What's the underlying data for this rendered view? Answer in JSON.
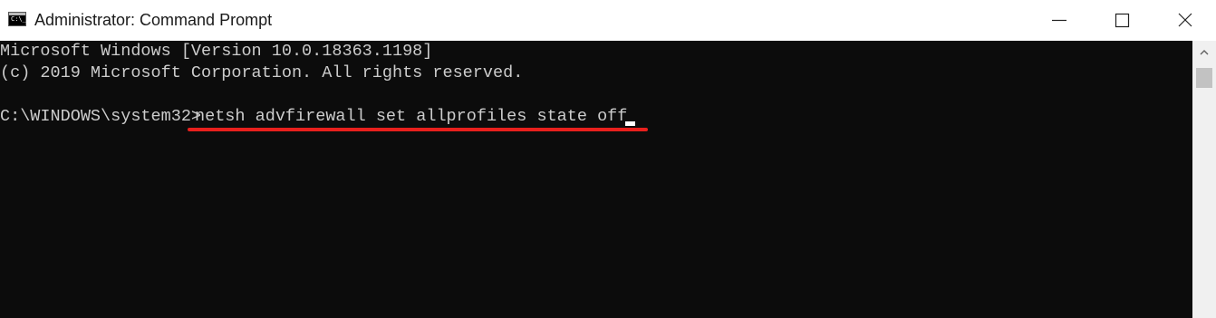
{
  "window": {
    "title": "Administrator: Command Prompt",
    "icon": "cmd-icon",
    "icon_text": "C:\\_"
  },
  "controls": {
    "minimize": "minimize-icon",
    "maximize": "maximize-icon",
    "close": "close-icon"
  },
  "console": {
    "lines": [
      "Microsoft Windows [Version 10.0.18363.1198]",
      "(c) 2019 Microsoft Corporation. All rights reserved.",
      ""
    ],
    "prompt": "C:\\WINDOWS\\system32>",
    "command": "netsh advfirewall set allprofiles state off"
  },
  "colors": {
    "background": "#0c0c0c",
    "text": "#cccccc",
    "highlight_underline": "#e8201d"
  }
}
